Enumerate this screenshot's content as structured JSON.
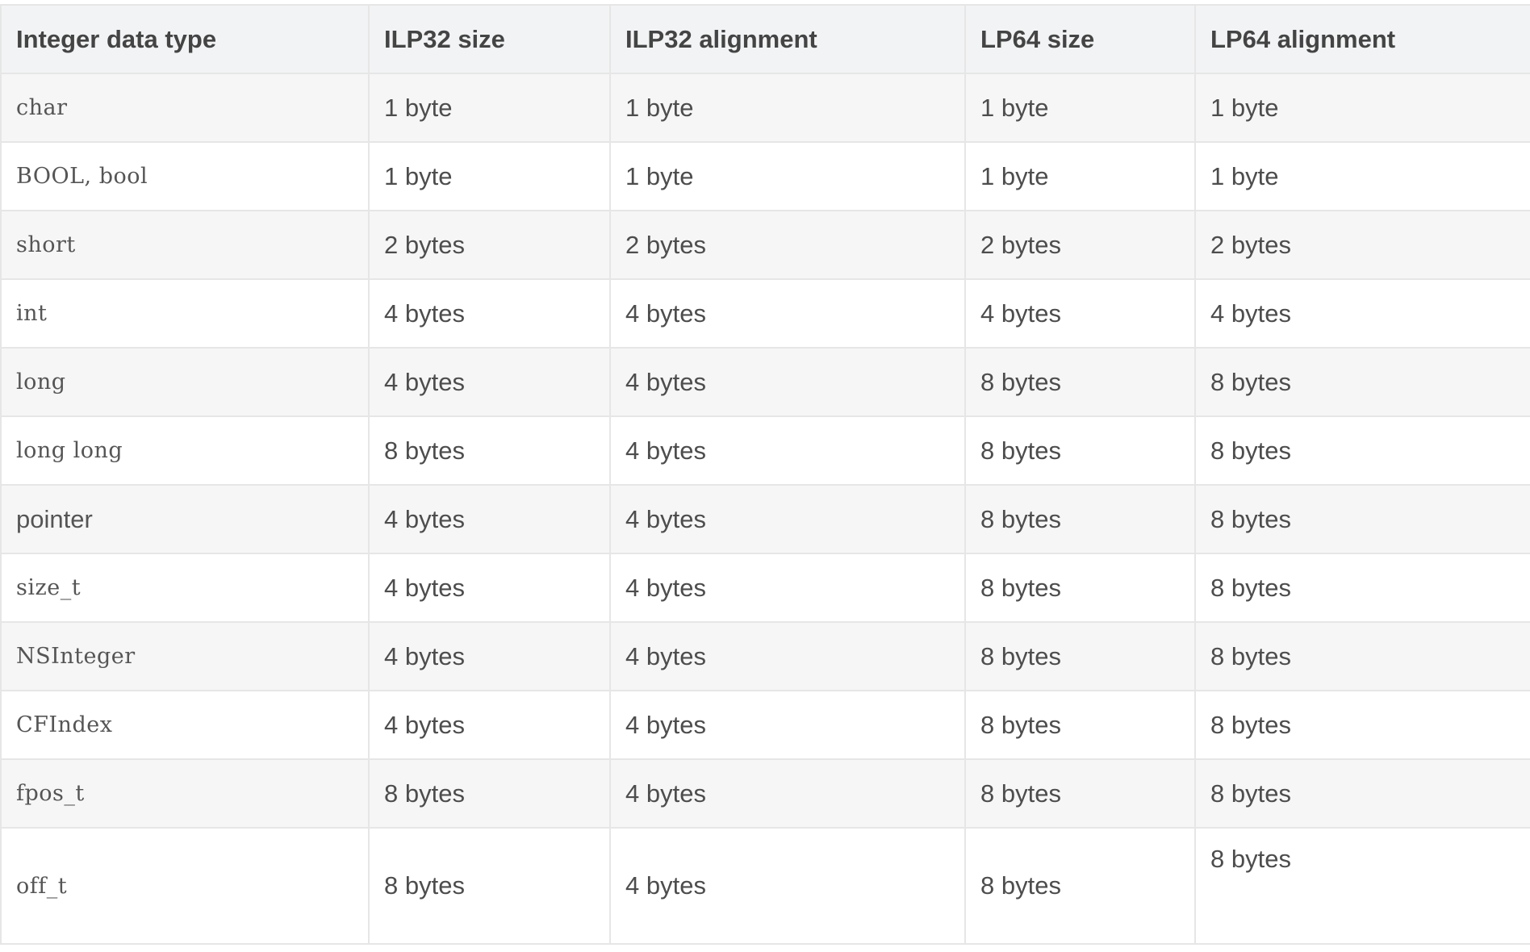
{
  "table": {
    "headers": [
      "Integer data type",
      "ILP32 size",
      "ILP32 alignment",
      "LP64 size",
      "LP64 alignment"
    ],
    "rows": [
      [
        "char",
        "1 byte",
        "1 byte",
        "1 byte",
        "1 byte"
      ],
      [
        "BOOL, bool",
        "1 byte",
        "1 byte",
        "1 byte",
        "1 byte"
      ],
      [
        "short",
        "2 bytes",
        "2 bytes",
        "2 bytes",
        "2 bytes"
      ],
      [
        "int",
        "4 bytes",
        "4 bytes",
        "4 bytes",
        "4 bytes"
      ],
      [
        "long",
        "4 bytes",
        "4 bytes",
        "8 bytes",
        "8 bytes"
      ],
      [
        "long long",
        "8 bytes",
        "4 bytes",
        "8 bytes",
        "8 bytes"
      ],
      [
        "pointer",
        "4 bytes",
        "4 bytes",
        "8 bytes",
        "8 bytes"
      ],
      [
        "size_t",
        "4 bytes",
        "4 bytes",
        "8 bytes",
        "8 bytes"
      ],
      [
        "NSInteger",
        "4 bytes",
        "4 bytes",
        "8 bytes",
        "8 bytes"
      ],
      [
        "CFIndex",
        "4 bytes",
        "4 bytes",
        "8 bytes",
        "8 bytes"
      ],
      [
        "fpos_t",
        "8 bytes",
        "4 bytes",
        "8 bytes",
        "8 bytes"
      ],
      [
        "off_t",
        "8 bytes",
        "4 bytes",
        "8 bytes",
        "8 bytes"
      ]
    ]
  }
}
